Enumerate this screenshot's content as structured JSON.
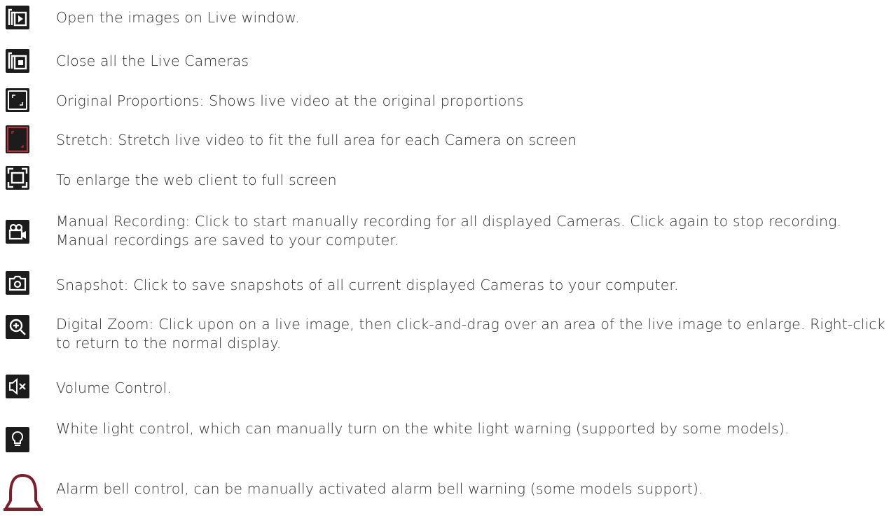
{
  "entries": [
    {
      "icon": "play-in-window-icon",
      "text": "Open the images on Live window."
    },
    {
      "icon": "stop-in-window-icon",
      "text": "Close all the Live Cameras"
    },
    {
      "icon": "original-proportions-icon",
      "text": "Original Proportions: Shows live video at the original proportions"
    },
    {
      "icon": "stretch-icon",
      "text": "Stretch: Stretch live video to fit the full area for each Camera on screen"
    },
    {
      "icon": "fullscreen-icon",
      "text": "To enlarge the web client to full screen"
    },
    {
      "icon": "video-camera-icon",
      "text": "Manual Recording: Click to start manually recording for all displayed Cameras. Click again to stop recording. Manual recordings are saved to your computer."
    },
    {
      "icon": "camera-icon",
      "text": "Snapshot: Click to save snapshots of all current displayed Cameras to your computer."
    },
    {
      "icon": "zoom-in-icon",
      "text": "Digital Zoom: Click upon on a live image, then click-and-drag over an area of the live image to enlarge. Right-click to return to the normal display."
    },
    {
      "icon": "volume-mute-icon",
      "text": "Volume Control."
    },
    {
      "icon": "light-bulb-icon",
      "text": "White light control, which can manually turn on the white light warning (supported by some models)."
    },
    {
      "icon": "bell-icon",
      "text": "Alarm bell control, can be manually activated alarm bell warning (some models support)."
    }
  ],
  "colors": {
    "tile": "#1c1c1c",
    "stretch_accent": "#b0343c",
    "bell": "#7a1f2b",
    "text": "#2e2e2e"
  }
}
